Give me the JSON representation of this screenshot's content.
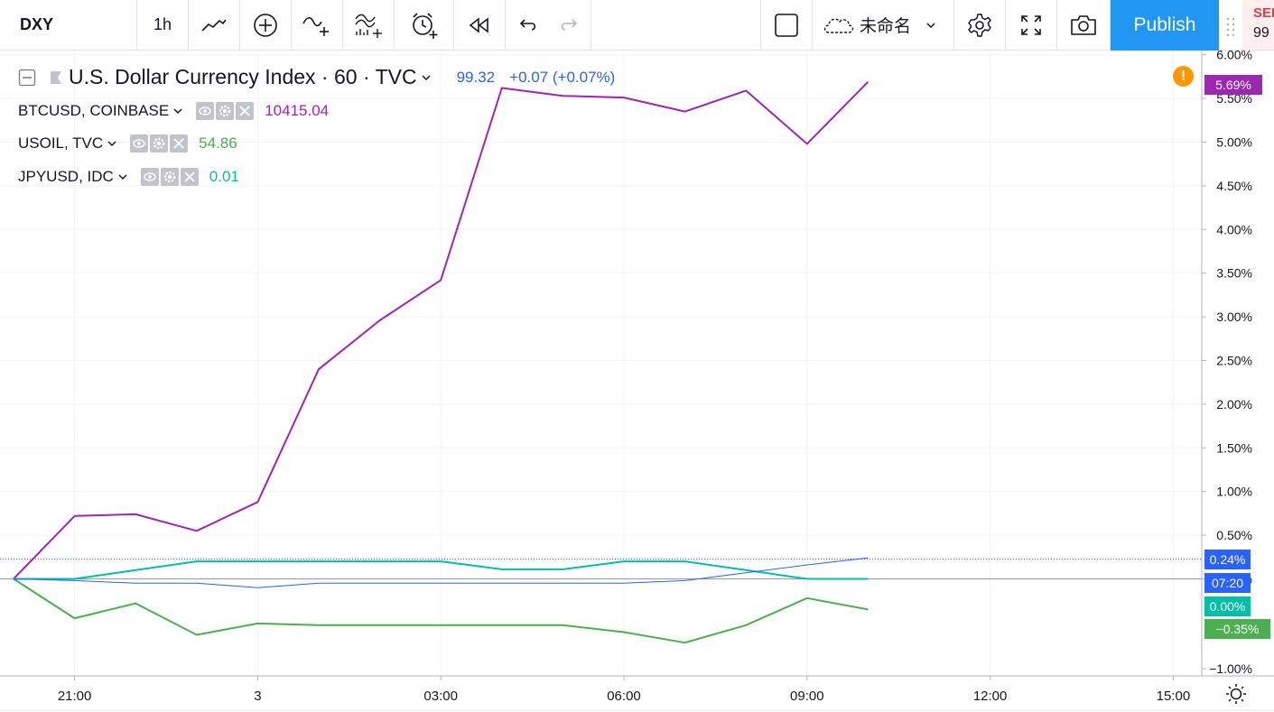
{
  "toolbar": {
    "symbol": "DXY",
    "interval": "1h",
    "layout_name": "未命名",
    "publish_label": "Publish",
    "sell_label": "SEL",
    "sell_price": "99"
  },
  "main_series": {
    "title": "U.S. Dollar Currency Index · 60 · TVC",
    "value": "99.32",
    "change": "+0.07 (+0.07%)"
  },
  "compare": [
    {
      "symbol": "BTCUSD, COINBASE",
      "value": "10415.04",
      "color": "#9c27b0"
    },
    {
      "symbol": "USOIL, TVC",
      "value": "54.86",
      "color": "#4caf50"
    },
    {
      "symbol": "JPYUSD, IDC",
      "value": "0.01",
      "color": "#00bfa5"
    }
  ],
  "axis_tags": {
    "btc": {
      "text": "5.69%",
      "color": "#9c27b0"
    },
    "dxy": {
      "text": "0.24%",
      "color": "#2962ff"
    },
    "countdown": {
      "text": "07:20",
      "color": "#2962ff"
    },
    "jpy": {
      "text": "0.00%",
      "color": "#00bfa5"
    },
    "oil": {
      "text": "−0.35%",
      "color": "#4caf50"
    }
  },
  "chart_data": {
    "type": "line",
    "x": [
      "20:00",
      "21:00",
      "22:00",
      "23:00",
      "3",
      "01:00",
      "02:00",
      "03:00",
      "04:00",
      "05:00",
      "06:00",
      "07:00",
      "08:00",
      "09:00",
      "10:00"
    ],
    "y_ticks": [
      "6.00%",
      "5.50%",
      "5.00%",
      "4.50%",
      "4.00%",
      "3.50%",
      "3.00%",
      "2.50%",
      "2.00%",
      "1.50%",
      "1.00%",
      "0.50%",
      "0.00%",
      "−1.00%"
    ],
    "x_ticks": [
      "21:00",
      "3",
      "03:00",
      "06:00",
      "09:00",
      "12:00",
      "15:00"
    ],
    "ylim": [
      -1.0,
      6.0
    ],
    "series": [
      {
        "name": "BTCUSD, COINBASE",
        "color": "#9c27b0",
        "values": [
          0,
          0.72,
          0.74,
          0.55,
          0.88,
          2.4,
          2.96,
          3.42,
          5.62,
          5.53,
          5.51,
          5.35,
          5.59,
          4.98,
          5.69
        ]
      },
      {
        "name": "USOIL, TVC",
        "color": "#4caf50",
        "values": [
          0,
          -0.45,
          -0.28,
          -0.64,
          -0.51,
          -0.53,
          -0.53,
          -0.53,
          -0.53,
          -0.53,
          -0.61,
          -0.73,
          -0.53,
          -0.22,
          -0.35
        ]
      },
      {
        "name": "JPYUSD, IDC",
        "color": "#00bfa5",
        "values": [
          0,
          0,
          0.1,
          0.2,
          0.2,
          0.2,
          0.2,
          0.2,
          0.11,
          0.11,
          0.2,
          0.2,
          0.1,
          0,
          0
        ]
      },
      {
        "name": "U.S. Dollar Currency Index",
        "color": "#2962ff",
        "values": [
          0,
          -0.02,
          -0.05,
          -0.05,
          -0.1,
          -0.05,
          -0.05,
          -0.05,
          -0.05,
          -0.05,
          -0.05,
          -0.02,
          0.07,
          0.16,
          0.24
        ]
      }
    ]
  }
}
